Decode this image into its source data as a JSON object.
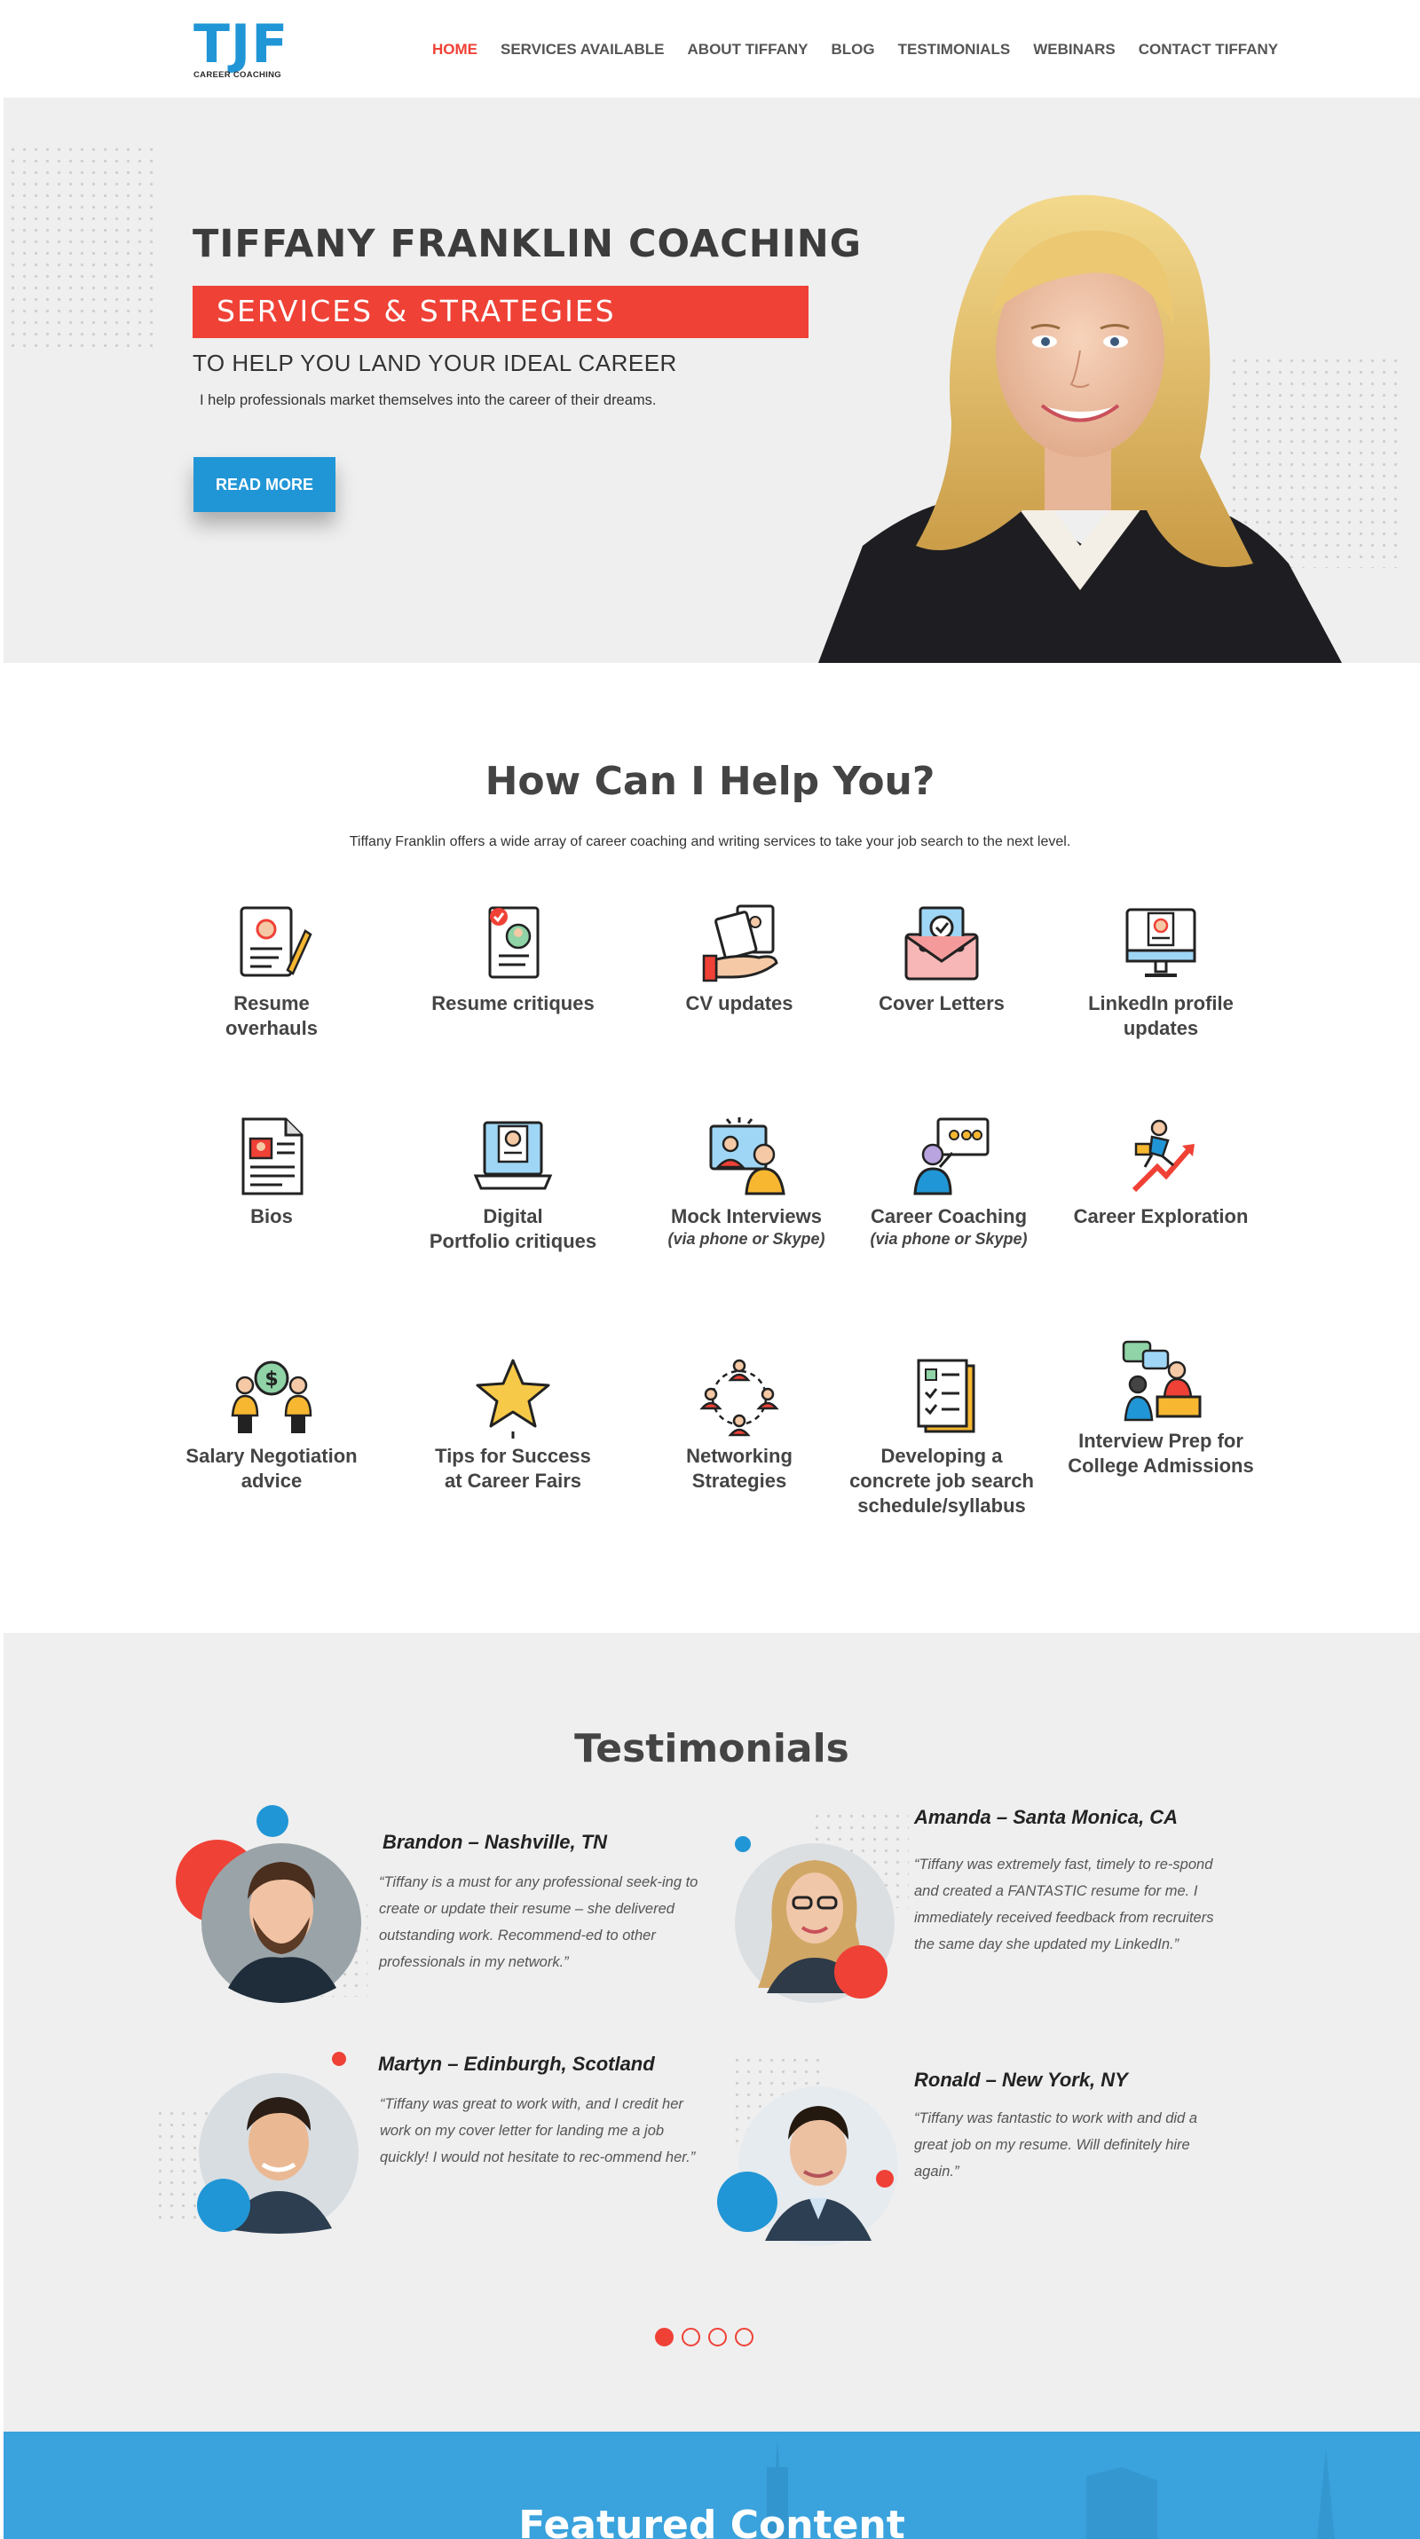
{
  "header": {
    "logo_text": "TJF",
    "logo_subtext": "CAREER COACHING",
    "nav": [
      {
        "label": "HOME",
        "active": true
      },
      {
        "label": "SERVICES AVAILABLE",
        "active": false
      },
      {
        "label": "ABOUT TIFFANY",
        "active": false
      },
      {
        "label": "BLOG",
        "active": false
      },
      {
        "label": "TESTIMONIALS",
        "active": false
      },
      {
        "label": "WEBINARS",
        "active": false
      },
      {
        "label": "CONTACT TIFFANY",
        "active": false
      }
    ]
  },
  "hero": {
    "title": "TIFFANY FRANKLIN COACHING",
    "band": "SERVICES & STRATEGIES",
    "subtitle": "TO HELP YOU LAND YOUR IDEAL CAREER",
    "description": "I help professionals market themselves into the career of their dreams.",
    "button": "READ MORE"
  },
  "services": {
    "title": "How Can I Help You?",
    "intro": "Tiffany Franklin offers a wide array of career coaching and writing services to take your job search to the next level.",
    "items": [
      {
        "label": "Resume\noverhauls",
        "icon": "resume-pencil-icon"
      },
      {
        "label": "Resume critiques",
        "icon": "resume-check-icon"
      },
      {
        "label": "CV updates",
        "icon": "cv-hand-icon"
      },
      {
        "label": "Cover Letters",
        "icon": "envelope-check-icon"
      },
      {
        "label": "LinkedIn profile\nupdates",
        "icon": "monitor-profile-icon"
      },
      {
        "label": "Bios",
        "icon": "bio-document-icon"
      },
      {
        "label": "Digital\nPortfolio critiques",
        "icon": "laptop-profile-icon"
      },
      {
        "label": "Mock Interviews",
        "note": "(via phone or Skype)",
        "icon": "video-interview-icon"
      },
      {
        "label": "Career Coaching",
        "note": "(via phone or Skype)",
        "icon": "presentation-coach-icon"
      },
      {
        "label": "Career Exploration",
        "icon": "growth-chart-icon"
      },
      {
        "label": "Salary Negotiation\nadvice",
        "icon": "salary-negotiation-icon"
      },
      {
        "label": "Tips for Success\nat Career Fairs",
        "icon": "star-icon"
      },
      {
        "label": "Networking\nStrategies",
        "icon": "network-people-icon"
      },
      {
        "label": "Developing a\nconcrete job search\nschedule/syllabus",
        "icon": "checklist-icon"
      },
      {
        "label": "Interview Prep for\nCollege Admissions",
        "icon": "interview-chat-icon"
      }
    ]
  },
  "testimonials": {
    "title": "Testimonials",
    "items": [
      {
        "name": "Brandon – Nashville, TN",
        "quote": "“Tiffany is a must for any professional seek-ing to create or update their resume – she delivered outstanding work. Recommend-ed to other professionals in my network.”"
      },
      {
        "name": "Amanda – Santa Monica, CA",
        "quote": "“Tiffany was extremely fast, timely to re-spond and created a FANTASTIC resume for me. I immediately received feedback from recruiters the same day she updated my LinkedIn.”"
      },
      {
        "name": "Martyn – Edinburgh, Scotland",
        "quote": "“Tiffany was great to work with, and I credit her work on my cover letter for landing me a job quickly! I would not hesitate to rec-ommend her.”"
      },
      {
        "name": "Ronald – New York, NY",
        "quote": "“Tiffany was fantastic to work with and did a great job on my resume. Will definitely hire again.”"
      }
    ],
    "carousel_active": 1,
    "carousel_count": 4
  },
  "featured": {
    "title": "Featured Content"
  },
  "colors": {
    "brand_blue": "#2196d6",
    "accent_red": "#ef4136",
    "hero_bg": "#efefef"
  }
}
